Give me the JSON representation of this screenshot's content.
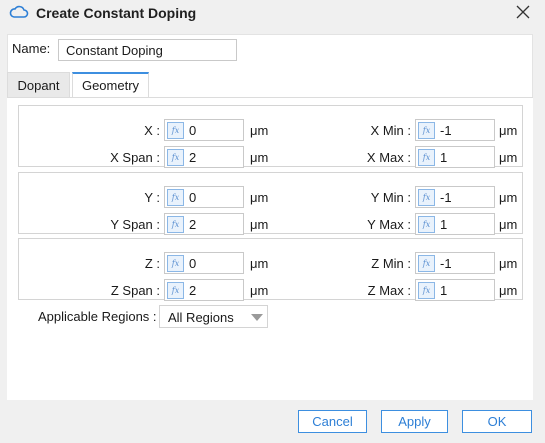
{
  "window": {
    "title": "Create Constant Doping",
    "icon": "cloud-icon",
    "close_icon": "close-icon"
  },
  "name": {
    "label": "Name:",
    "value": "Constant Doping"
  },
  "tabs": [
    {
      "label": "Dopant",
      "active": false
    },
    {
      "label": "Geometry",
      "active": true
    }
  ],
  "geometry": {
    "groups": [
      {
        "rows": [
          {
            "left_label": "X :",
            "left_value": "0",
            "left_unit": "μm",
            "right_label": "X Min :",
            "right_value": "-1",
            "right_unit": "μm"
          },
          {
            "left_label": "X Span :",
            "left_value": "2",
            "left_unit": "μm",
            "right_label": "X Max :",
            "right_value": "1",
            "right_unit": "μm"
          }
        ]
      },
      {
        "rows": [
          {
            "left_label": "Y :",
            "left_value": "0",
            "left_unit": "μm",
            "right_label": "Y Min :",
            "right_value": "-1",
            "right_unit": "μm"
          },
          {
            "left_label": "Y Span :",
            "left_value": "2",
            "left_unit": "μm",
            "right_label": "Y Max :",
            "right_value": "1",
            "right_unit": "μm"
          }
        ]
      },
      {
        "rows": [
          {
            "left_label": "Z :",
            "left_value": "0",
            "left_unit": "μm",
            "right_label": "Z Min :",
            "right_value": "-1",
            "right_unit": "μm"
          },
          {
            "left_label": "Z Span :",
            "left_value": "2",
            "left_unit": "μm",
            "right_label": "Z Max :",
            "right_value": "1",
            "right_unit": "μm"
          }
        ]
      }
    ],
    "fx_icon_text": "fx"
  },
  "applicable_regions": {
    "label": "Applicable Regions :",
    "value": "All Regions"
  },
  "buttons": {
    "cancel": "Cancel",
    "apply": "Apply",
    "ok": "OK"
  },
  "colors": {
    "accent": "#3d8fe0",
    "button_text": "#2d7fd6",
    "fx_bg": "#e9f2fc"
  }
}
